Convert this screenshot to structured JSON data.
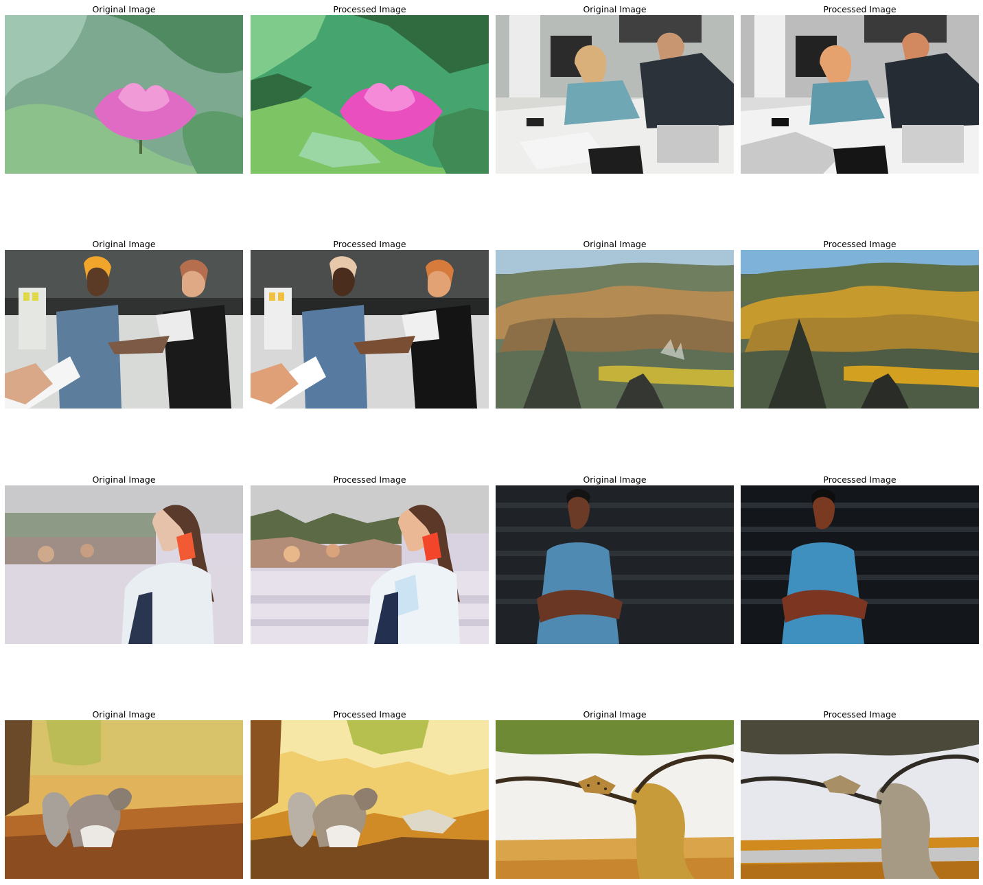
{
  "figure": {
    "panels": [
      {
        "title": "Original Image",
        "scene": "lotus",
        "variant": "original"
      },
      {
        "title": "Processed Image",
        "scene": "lotus",
        "variant": "processed"
      },
      {
        "title": "Original Image",
        "scene": "office",
        "variant": "original"
      },
      {
        "title": "Processed Image",
        "scene": "office",
        "variant": "processed"
      },
      {
        "title": "Original Image",
        "scene": "handshake",
        "variant": "original"
      },
      {
        "title": "Processed Image",
        "scene": "handshake",
        "variant": "processed"
      },
      {
        "title": "Original Image",
        "scene": "mountains",
        "variant": "original"
      },
      {
        "title": "Processed Image",
        "scene": "mountains",
        "variant": "processed"
      },
      {
        "title": "Original Image",
        "scene": "phone-woman",
        "variant": "original"
      },
      {
        "title": "Processed Image",
        "scene": "phone-woman",
        "variant": "processed"
      },
      {
        "title": "Original Image",
        "scene": "smiling-man",
        "variant": "original"
      },
      {
        "title": "Processed Image",
        "scene": "smiling-man",
        "variant": "processed"
      },
      {
        "title": "Original Image",
        "scene": "squirrel",
        "variant": "original"
      },
      {
        "title": "Processed Image",
        "scene": "squirrel",
        "variant": "processed"
      },
      {
        "title": "Original Image",
        "scene": "tree-leopard",
        "variant": "original"
      },
      {
        "title": "Processed Image",
        "scene": "tree-leopard",
        "variant": "processed"
      }
    ]
  }
}
